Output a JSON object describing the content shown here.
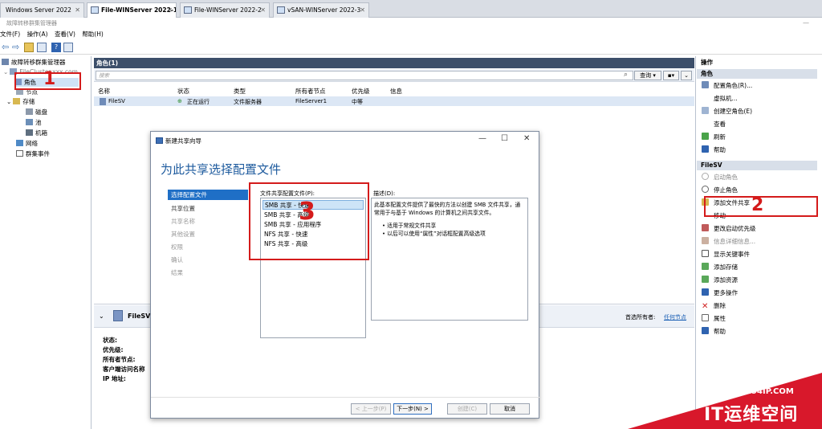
{
  "browser_tabs": [
    {
      "label": "Windows Server 2022"
    },
    {
      "label": "File-WINServer 2022-1"
    },
    {
      "label": "File-WINServer 2022-2"
    },
    {
      "label": "vSAN-WINServer 2022-3"
    }
  ],
  "app": {
    "title": "故障转移群集管理器",
    "menu": [
      "文件(F)",
      "操作(A)",
      "查看(V)",
      "帮助(H)"
    ],
    "window_min": "—"
  },
  "tree": {
    "root": "故障转移群集管理器",
    "cluster": "FileCluster.xxx.com",
    "roles": "角色",
    "nodes": "节点",
    "storage": "存储",
    "disks": "磁盘",
    "pools": "池",
    "enclosures": "机箱",
    "networks": "网络",
    "events": "群集事件"
  },
  "center": {
    "header": "角色(1)",
    "search_placeholder": "搜索",
    "query_button": "查询",
    "columns": [
      "名称",
      "状态",
      "类型",
      "所有者节点",
      "优先级",
      "信息"
    ],
    "rows": [
      {
        "name": "FileSV",
        "status": "正在运行",
        "type": "文件服务器",
        "owner": "FileServer1",
        "priority": "中等",
        "info": ""
      }
    ]
  },
  "detail": {
    "name": "FileSV",
    "preferred_owner_label": "首选所有者:",
    "preferred_owner_link": "任何节点",
    "labels": [
      "状态:",
      "优先级:",
      "所有者节点:",
      "客户端访问名称",
      "IP 地址:"
    ]
  },
  "right": {
    "section1_title": "操作",
    "section1_sub": "角色",
    "actions1": [
      "配置角色(R)...",
      "虚拟机...",
      "创建空角色(E)",
      "查看",
      "刷新",
      "帮助"
    ],
    "section2_title": "FileSV",
    "actions2": [
      "启动角色",
      "停止角色",
      "添加文件共享",
      "移动",
      "更改启动优先级",
      "信息详细信息...",
      "显示关键事件",
      "添加存储",
      "添加资源",
      "更多操作",
      "删除",
      "属性",
      "帮助"
    ]
  },
  "dialog": {
    "title": "新建共享向导",
    "minimize": "—",
    "maximize": "☐",
    "close": "✕",
    "heading": "为此共享选择配置文件",
    "steps": [
      "选择配置文件",
      "共享位置",
      "共享名称",
      "其他设置",
      "权限",
      "确认",
      "结果"
    ],
    "profile_label": "文件共享配置文件(P):",
    "profiles": [
      "SMB 共享 - 快速",
      "SMB 共享 - 高级",
      "SMB 共享 - 应用程序",
      "NFS 共享 - 快速",
      "NFS 共享 - 高级"
    ],
    "desc_label": "描述(D):",
    "desc_text": "此基本配置文件提供了最快的方法以创建 SMB 文件共享，通常用于与基于 Windows 的计算机之间共享文件。",
    "desc_bullets": [
      "适用于常规文件共享",
      "以后可以使用“属性”对话框配置高级选项"
    ],
    "buttons": {
      "prev": "< 上一步(P)",
      "next": "下一步(N) >",
      "create": "创建(C)",
      "cancel": "取消"
    }
  },
  "annotations": [
    "1",
    "2",
    "3"
  ],
  "watermark": {
    "url": "WWW.94IP.COM",
    "text": "IT运维空间"
  },
  "colors": {
    "accent": "#1f6fc6",
    "annotation": "#d41b1b",
    "watermark": "#d8182b",
    "header": "#3c4f6a"
  }
}
